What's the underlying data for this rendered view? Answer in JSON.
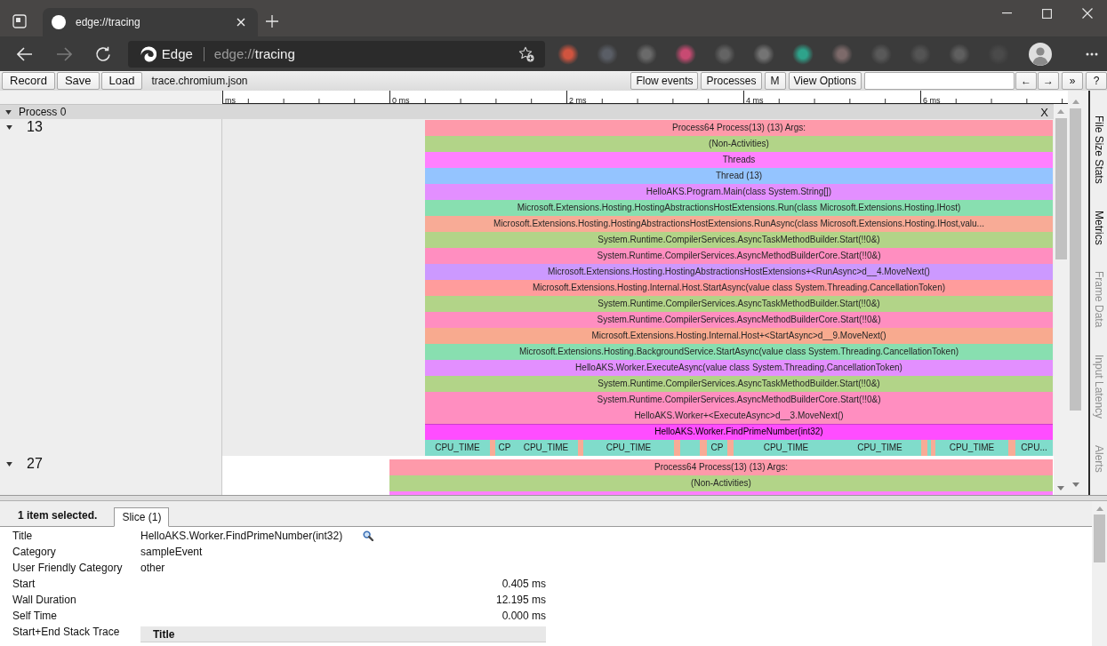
{
  "browser": {
    "tabs": [
      {
        "title": "edge://tracing",
        "selected": true
      }
    ],
    "nav_buttons": [
      {
        "kind": "back",
        "disabled": false
      },
      {
        "kind": "forward",
        "disabled": true
      },
      {
        "kind": "reload",
        "disabled": false
      }
    ],
    "address": {
      "brand": "Edge",
      "scheme": "edge://",
      "host": "tracing"
    }
  },
  "toolbar": {
    "buttons": [
      "Record",
      "Save",
      "Load"
    ],
    "filename": "trace.chromium.json",
    "view_buttons": [
      "Flow events",
      "Processes",
      "M",
      "View Options"
    ],
    "nav_buttons": [
      "←",
      "→"
    ],
    "extra_buttons": [
      "»",
      "?"
    ]
  },
  "ruler": {
    "labels": [
      "ms",
      "0 ms",
      "2 ms",
      "4 ms",
      "6 ms"
    ]
  },
  "process": {
    "title": "Process 0",
    "expanded": true,
    "close": "X",
    "tracks": [
      {
        "label": "13",
        "expanded": true,
        "slices": [
          {
            "label": "Process64 Process(13) (13) Args:",
            "color": "#fe9aaa",
            "selected": false
          },
          {
            "label": "(Non-Activities)",
            "color": "#b2d488",
            "selected": false
          },
          {
            "label": "Threads",
            "color": "#ff80ff",
            "selected": false
          },
          {
            "label": "Thread (13)",
            "color": "#94c4ff",
            "selected": false
          },
          {
            "label": "HelloAKS.Program.Main(class System.String[])",
            "color": "#e38fff",
            "selected": false
          },
          {
            "label": "Microsoft.Extensions.Hosting.HostingAbstractionsHostExtensions.Run(class Microsoft.Extensions.Hosting.IHost)",
            "color": "#88dfb0",
            "selected": false
          },
          {
            "label": "Microsoft.Extensions.Hosting.HostingAbstractionsHostExtensions.RunAsync(class Microsoft.Extensions.Hosting.IHost,valu...",
            "color": "#f8ab96",
            "selected": false
          },
          {
            "label": "System.Runtime.CompilerServices.AsyncTaskMethodBuilder.Start(!!0&)",
            "color": "#b2d488",
            "selected": false
          },
          {
            "label": "System.Runtime.CompilerServices.AsyncMethodBuilderCore.Start(!!0&)",
            "color": "#ff8ec0",
            "selected": false
          },
          {
            "label": "Microsoft.Extensions.Hosting.HostingAbstractionsHostExtensions+<RunAsync>d__4.MoveNext()",
            "color": "#cc99ff",
            "selected": false
          },
          {
            "label": "Microsoft.Extensions.Hosting.Internal.Host.StartAsync(value class System.Threading.CancellationToken)",
            "color": "#ff9c9c",
            "selected": false
          },
          {
            "label": "System.Runtime.CompilerServices.AsyncTaskMethodBuilder.Start(!!0&)",
            "color": "#b2d488",
            "selected": false
          },
          {
            "label": "System.Runtime.CompilerServices.AsyncMethodBuilderCore.Start(!!0&)",
            "color": "#ff8ec0",
            "selected": false
          },
          {
            "label": "Microsoft.Extensions.Hosting.Internal.Host+<StartAsync>d__9.MoveNext()",
            "color": "#f8aa8f",
            "selected": false
          },
          {
            "label": "Microsoft.Extensions.Hosting.BackgroundService.StartAsync(value class System.Threading.CancellationToken)",
            "color": "#88dfb0",
            "selected": false
          },
          {
            "label": "HelloAKS.Worker.ExecuteAsync(value class System.Threading.CancellationToken)",
            "color": "#e38fff",
            "selected": false
          },
          {
            "label": "System.Runtime.CompilerServices.AsyncTaskMethodBuilder.Start(!!0&)",
            "color": "#b2d488",
            "selected": false
          },
          {
            "label": "System.Runtime.CompilerServices.AsyncMethodBuilderCore.Start(!!0&)",
            "color": "#ff8ec0",
            "selected": false
          },
          {
            "label": "HelloAKS.Worker+<ExecuteAsync>d__3.MoveNext()",
            "color": "#ff8ec0",
            "selected": false
          },
          {
            "label": "HelloAKS.Worker.FindPrimeNumber(int32)",
            "color": "#ff4dff",
            "selected": true
          }
        ],
        "samples": [
          {
            "label": "CPU_TIME",
            "color": "#80dccb"
          },
          {
            "color": "#f8ab96"
          },
          {
            "label": "CP",
            "color": "#80dccb"
          },
          {
            "label": "CPU_TIME",
            "color": "#80dccb"
          },
          {
            "color": "#f8ab96"
          },
          {
            "label": "CPU_TIME",
            "color": "#80dccb"
          },
          {
            "color": "#f8ab96"
          },
          {
            "color": "#80dccb"
          },
          {
            "color": "#80dccb"
          },
          {
            "color": "#f8ab96"
          },
          {
            "label": "CP",
            "color": "#80dccb"
          },
          {
            "color": "#f8ab96"
          },
          {
            "label": "CPU_TIME",
            "color": "#80dccb"
          },
          {
            "label": "CPU_TIME",
            "color": "#80dccb"
          },
          {
            "color": "#f8ab96"
          },
          {
            "color": "#80dccb"
          },
          {
            "color": "#f8ab96"
          },
          {
            "label": "CPU_TIME",
            "color": "#80dccb"
          },
          {
            "color": "#f8ab96"
          },
          {
            "label": "CPU...",
            "color": "#80dccb"
          }
        ]
      },
      {
        "label": "27",
        "expanded": true,
        "slices": [
          {
            "label": "Process64 Process(13) (13) Args:",
            "color": "#fe9aaa",
            "selected": false
          },
          {
            "label": "(Non-Activities)",
            "color": "#b2d488",
            "selected": false
          },
          {
            "color": "#ff80ff",
            "selected": false
          }
        ]
      }
    ]
  },
  "side_tabs": [
    {
      "label": "File Size Stats",
      "disabled": false
    },
    {
      "label": "Metrics",
      "disabled": false
    },
    {
      "label": "Frame Data",
      "disabled": true
    },
    {
      "label": "Input Latency",
      "disabled": true
    },
    {
      "label": "Alerts",
      "disabled": true
    }
  ],
  "analysis": {
    "summary": "1 item selected.",
    "tabs": [
      {
        "label": "Slice (1)",
        "selected": true
      }
    ],
    "rows": [
      {
        "label": "Title",
        "value": "HelloAKS.Worker.FindPrimeNumber(int32)",
        "kind": "searchable"
      },
      {
        "label": "Category",
        "value": "sampleEvent",
        "kind": "text"
      },
      {
        "label": "User Friendly Category",
        "value": "other",
        "kind": "text"
      },
      {
        "label": "Start",
        "value": "0.405 ms",
        "kind": "number"
      },
      {
        "label": "Wall Duration",
        "value": "12.195 ms",
        "kind": "number"
      },
      {
        "label": "Self Time",
        "value": "0.000 ms",
        "kind": "number"
      },
      {
        "label": "Start+End Stack Trace",
        "kind": "table",
        "columns": [
          "Title"
        ]
      }
    ]
  }
}
